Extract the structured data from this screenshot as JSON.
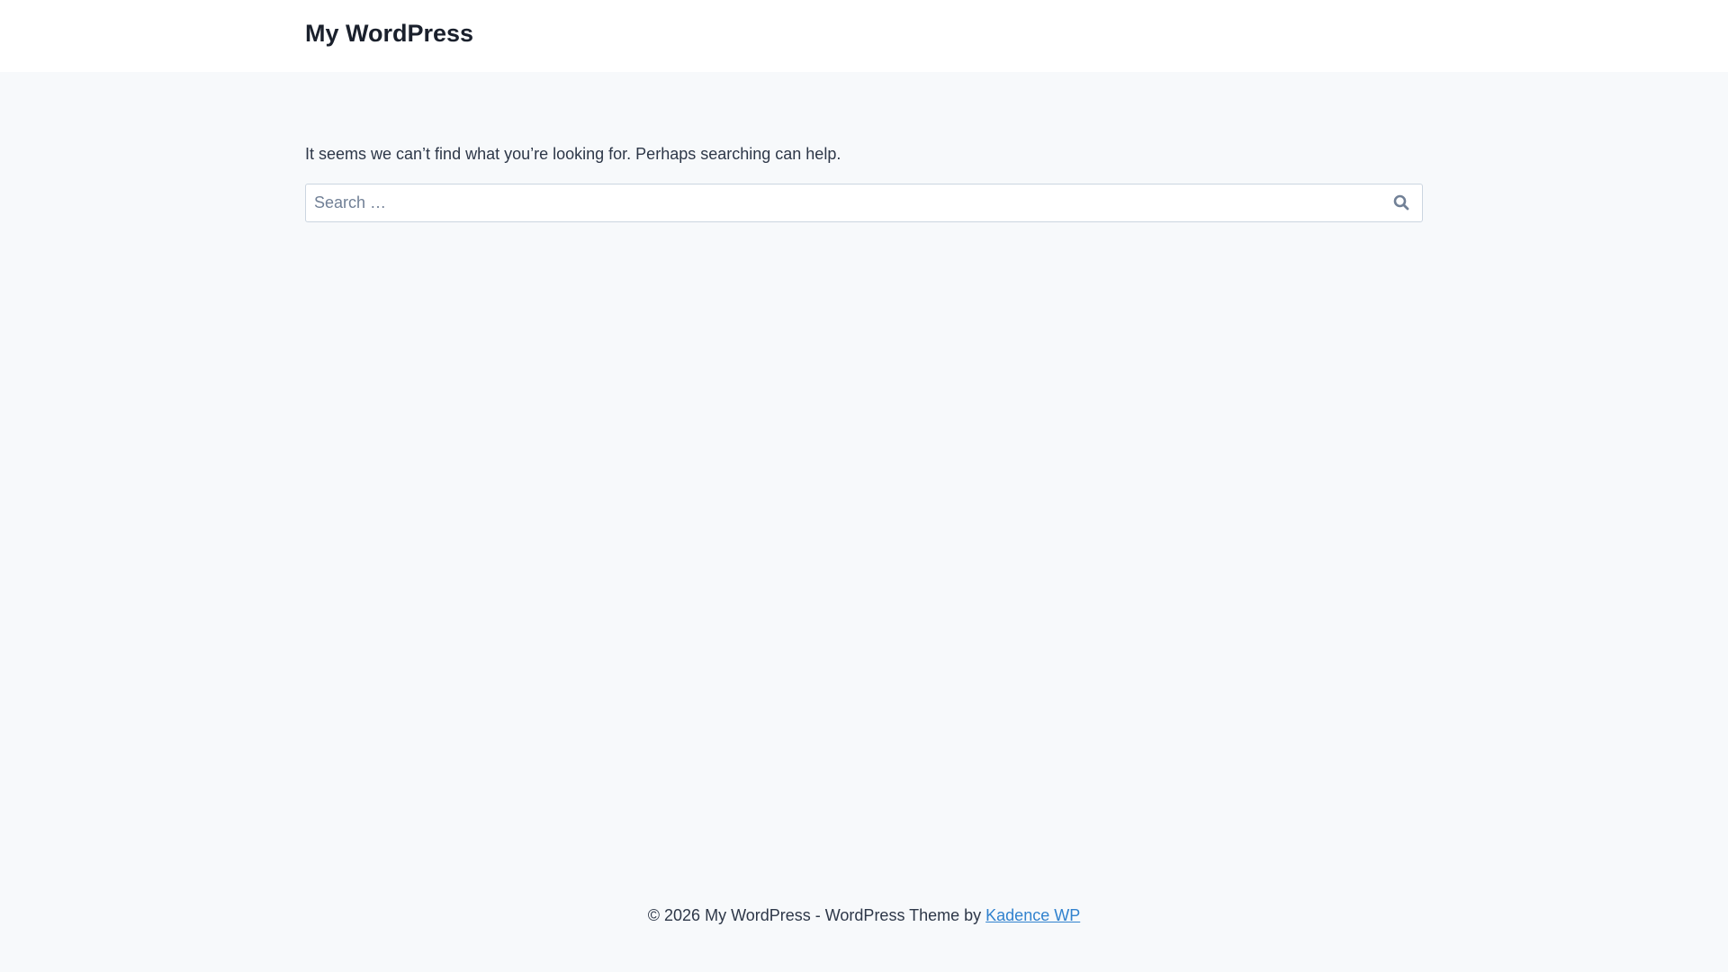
{
  "header": {
    "site_title": "My WordPress"
  },
  "main": {
    "message": "It seems we can’t find what you’re looking for. Perhaps searching can help.",
    "search": {
      "placeholder": "Search …",
      "value": "",
      "button_icon": "search-icon"
    }
  },
  "footer": {
    "text": "© 2026 My WordPress - WordPress Theme by ",
    "link_label": "Kadence WP"
  }
}
